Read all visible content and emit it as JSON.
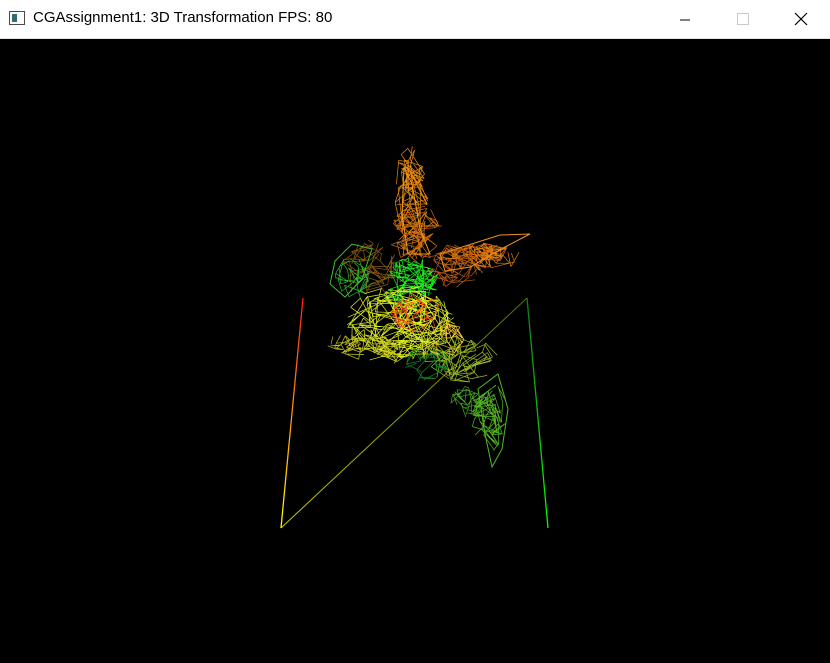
{
  "window": {
    "title": "CGAssignment1: 3D Transformation FPS: 80"
  },
  "controls": {
    "minimize": "minimize-icon",
    "maximize": "maximize-icon",
    "close": "close-icon"
  },
  "scene": {
    "background": "#000000",
    "floor_colors": [
      "#ff2020",
      "#ffff00",
      "#00ff00",
      "#b0ff40"
    ],
    "model_colors": [
      "#ff9900",
      "#ffff33",
      "#33ff33",
      "#ff4400",
      "#ccff33"
    ]
  }
}
